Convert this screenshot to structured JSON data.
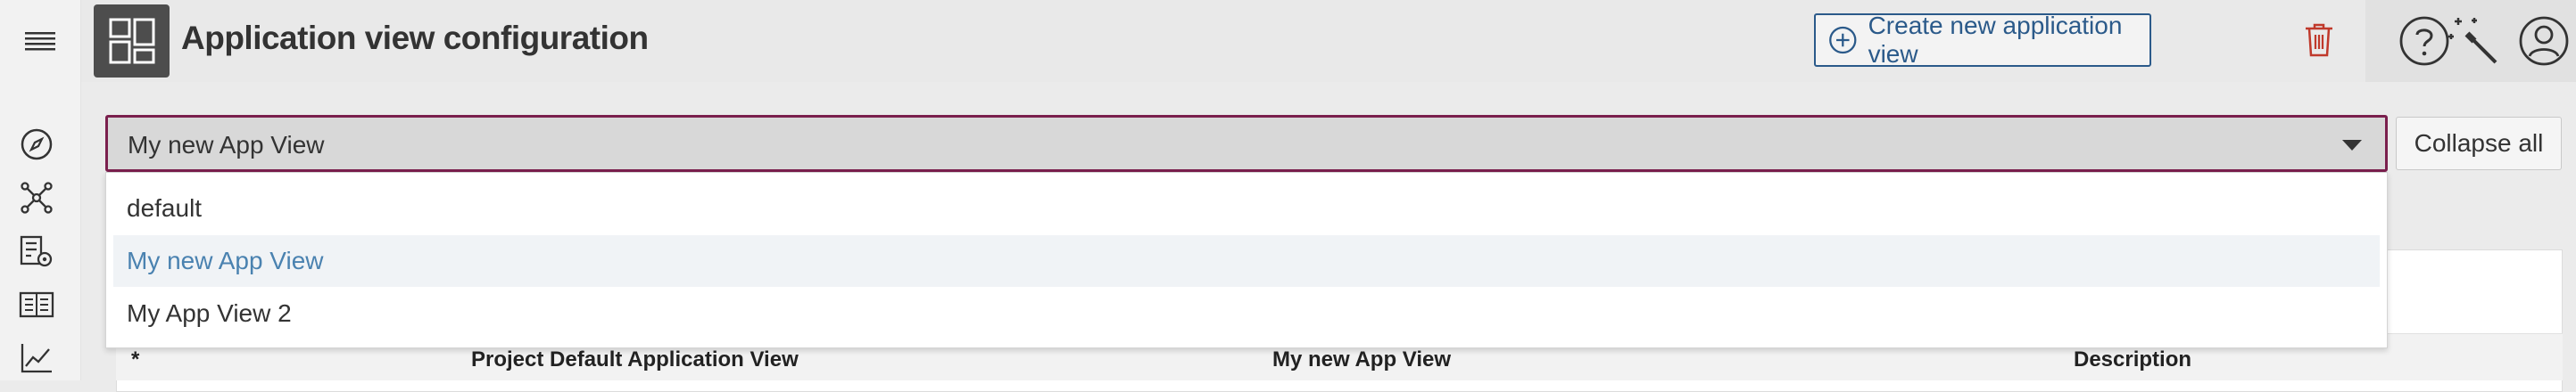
{
  "header": {
    "title": "Application view configuration",
    "create_label": "Create new application view"
  },
  "select": {
    "value": "My new App View",
    "options": [
      {
        "label": "default"
      },
      {
        "label": "My new App View",
        "selected": true
      },
      {
        "label": "My App View 2"
      }
    ]
  },
  "actions": {
    "collapse_label": "Collapse all"
  },
  "table": {
    "columns": [
      "*",
      "Project Default Application View",
      "My new App View",
      "Description"
    ]
  },
  "icons": {
    "menu": "hamburger-icon",
    "app_tile": "application-grid-icon",
    "create": "plus-circle-icon",
    "delete": "trash-icon",
    "help": "help-icon",
    "wand": "magic-wand-icon",
    "user": "user-icon",
    "nav": [
      "compass-icon",
      "network-icon",
      "list-view-icon",
      "book-icon",
      "chart-icon"
    ]
  },
  "colors": {
    "accent": "#2b5a8a",
    "focus_border": "#7a1f4d",
    "danger": "#c0392b",
    "selected_text": "#4a82b0"
  }
}
